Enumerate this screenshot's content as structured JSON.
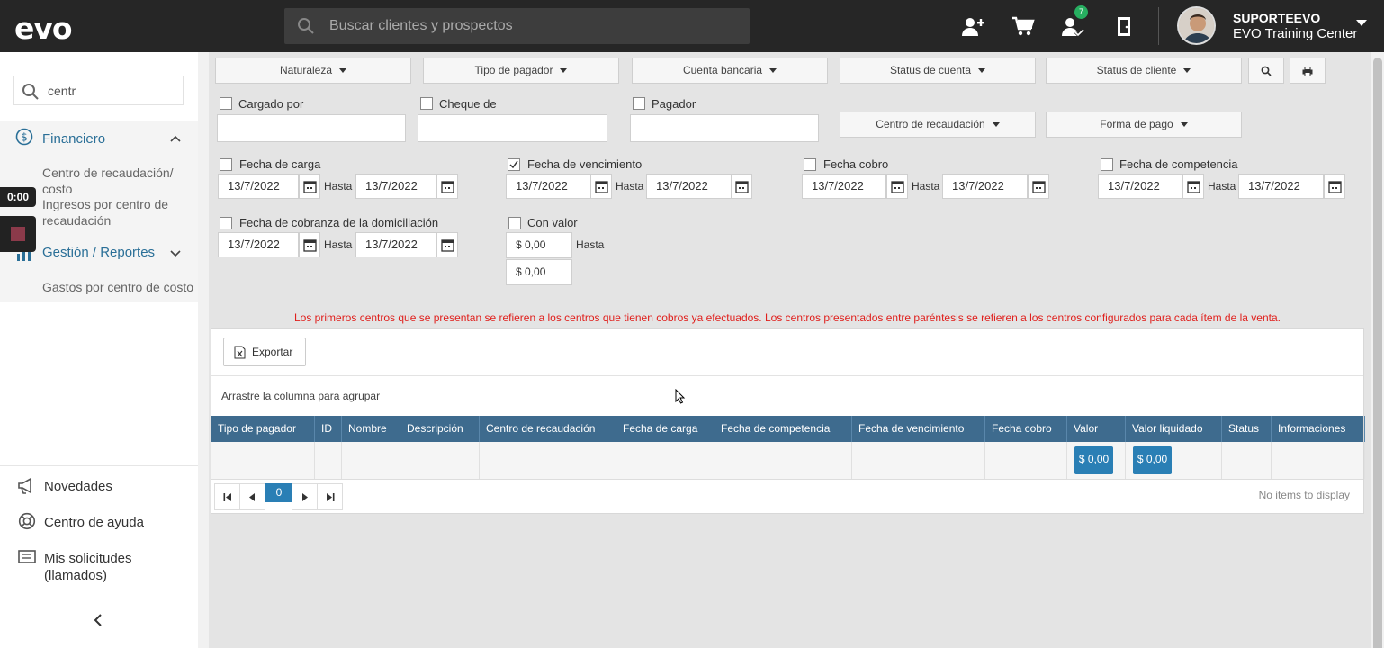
{
  "header": {
    "logo": "evo",
    "search_placeholder": "Buscar clientes y prospectos",
    "badge_count": "7",
    "user_name": "SUPORTEEVO",
    "user_center": "EVO Training Center"
  },
  "sidebar": {
    "search_value": "centr",
    "section_financiero": "Financiero",
    "items_financiero": [
      "Centro de recaudación/ costo",
      "Ingresos por centro de recaudación"
    ],
    "section_gestion": "Gestión / Reportes",
    "items_gestion": [
      "Gastos por centro de costo"
    ],
    "footer": [
      "Novedades",
      "Centro de ayuda",
      "Mis solicitudes (llamados)"
    ],
    "timer": "0:00"
  },
  "filters": {
    "dropdowns": [
      "Naturaleza",
      "Tipo de pagador",
      "Cuenta bancaria",
      "Status de cuenta",
      "Status de cliente"
    ],
    "dropdowns_row2": [
      "Centro de recaudación",
      "Forma de pago"
    ],
    "text_fields": [
      "Cargado por",
      "Cheque de",
      "Pagador"
    ],
    "date_groups": [
      {
        "label": "Fecha de carga",
        "checked": false,
        "from": "13/7/2022",
        "to": "13/7/2022"
      },
      {
        "label": "Fecha de vencimiento",
        "checked": true,
        "from": "13/7/2022",
        "to": "13/7/2022"
      },
      {
        "label": "Fecha cobro",
        "checked": false,
        "from": "13/7/2022",
        "to": "13/7/2022"
      },
      {
        "label": "Fecha de competencia",
        "checked": false,
        "from": "13/7/2022",
        "to": "13/7/2022"
      },
      {
        "label": "Fecha de cobranza de la domiciliación",
        "checked": false,
        "from": "13/7/2022",
        "to": "13/7/2022"
      }
    ],
    "hasta": "Hasta",
    "con_valor": {
      "label": "Con valor",
      "from": "$ 0,00",
      "to": "$ 0,00"
    }
  },
  "warning": "Los primeros centros que se presentan se refieren a los centros que tienen cobros ya efectuados. Los centros presentados entre paréntesis se refieren a los centros configurados para cada ítem de la venta.",
  "grid": {
    "export_label": "Exportar",
    "group_hint": "Arrastre la columna para agrupar",
    "columns": [
      "Tipo de pagador",
      "ID",
      "Nombre",
      "Descripción",
      "Centro de recaudación",
      "Fecha de carga",
      "Fecha de competencia",
      "Fecha de vencimiento",
      "Fecha cobro",
      "Valor",
      "Valor liquidado",
      "Status",
      "Informaciones"
    ],
    "total_valor": "$ 0,00",
    "total_valor_liquidado": "$ 0,00",
    "page": "0",
    "no_items": "No items to display"
  }
}
